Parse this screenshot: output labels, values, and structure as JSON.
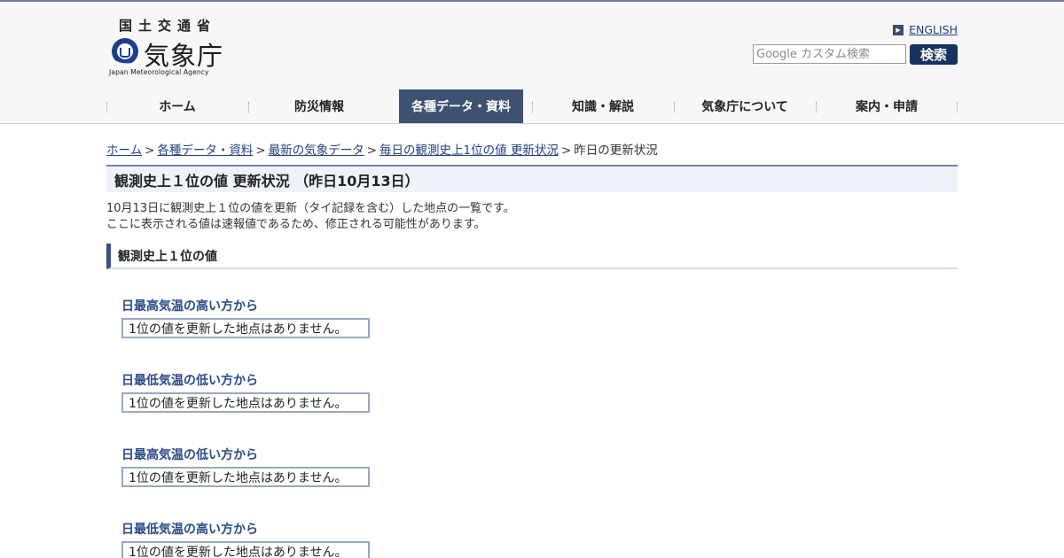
{
  "header": {
    "ministry": "国土交通省",
    "agency": "気象庁",
    "agency_en": "Japan Meteorological Agency",
    "english_link": "ENGLISH",
    "search_placeholder": "Google カスタム検索",
    "search_button": "検索"
  },
  "nav": {
    "items": [
      {
        "label": "ホーム"
      },
      {
        "label": "防災情報"
      },
      {
        "label": "各種データ・資料"
      },
      {
        "label": "知識・解説"
      },
      {
        "label": "気象庁について"
      },
      {
        "label": "案内・申請"
      }
    ],
    "active_index": 2
  },
  "breadcrumb": {
    "items": [
      "ホーム",
      "各種データ・資料",
      "最新の気象データ",
      "毎日の観測史上1位の値 更新状況"
    ],
    "current": "昨日の更新状況",
    "separator": ">"
  },
  "page": {
    "title": "観測史上１位の値 更新状況 （昨日10月13日）",
    "desc_line1": "10月13日に観測史上１位の値を更新（タイ記録を含む）した地点の一覧です。",
    "desc_line2": "ここに表示される値は速報値であるため、修正される可能性があります。",
    "section_title": "観測史上１位の値"
  },
  "blocks": [
    {
      "title": "日最高気温の高い方から",
      "message": "1位の値を更新した地点はありません。"
    },
    {
      "title": "日最低気温の低い方から",
      "message": "1位の値を更新した地点はありません。"
    },
    {
      "title": "日最高気温の低い方から",
      "message": "1位の値を更新した地点はありません。"
    },
    {
      "title": "日最低気温の高い方から",
      "message": "1位の値を更新した地点はありません。"
    }
  ],
  "colors": {
    "nav_active": "#3d5270",
    "link": "#23417f",
    "block_title": "#2b4a88",
    "search_button": "#17325c"
  }
}
